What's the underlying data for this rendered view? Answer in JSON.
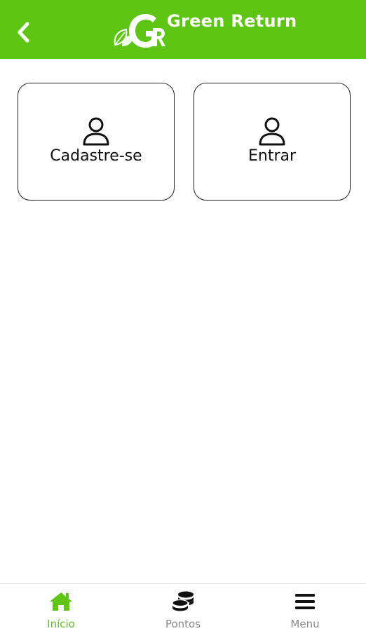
{
  "header": {
    "app_name": "Green Return",
    "logo_letters": "GR",
    "background_color": "#5fc514",
    "back_icon": "chevron-left-icon"
  },
  "main": {
    "cards": [
      {
        "label": "Cadastre-se",
        "icon": "user-icon"
      },
      {
        "label": "Entrar",
        "icon": "user-icon"
      }
    ]
  },
  "bottom_nav": {
    "active_color": "#5fc514",
    "inactive_color": "#8a8a8a",
    "items": [
      {
        "label": "Início",
        "icon": "home-icon",
        "active": true
      },
      {
        "label": "Pontos",
        "icon": "coins-icon",
        "active": false
      },
      {
        "label": "Menu",
        "icon": "menu-icon",
        "active": false
      }
    ]
  }
}
